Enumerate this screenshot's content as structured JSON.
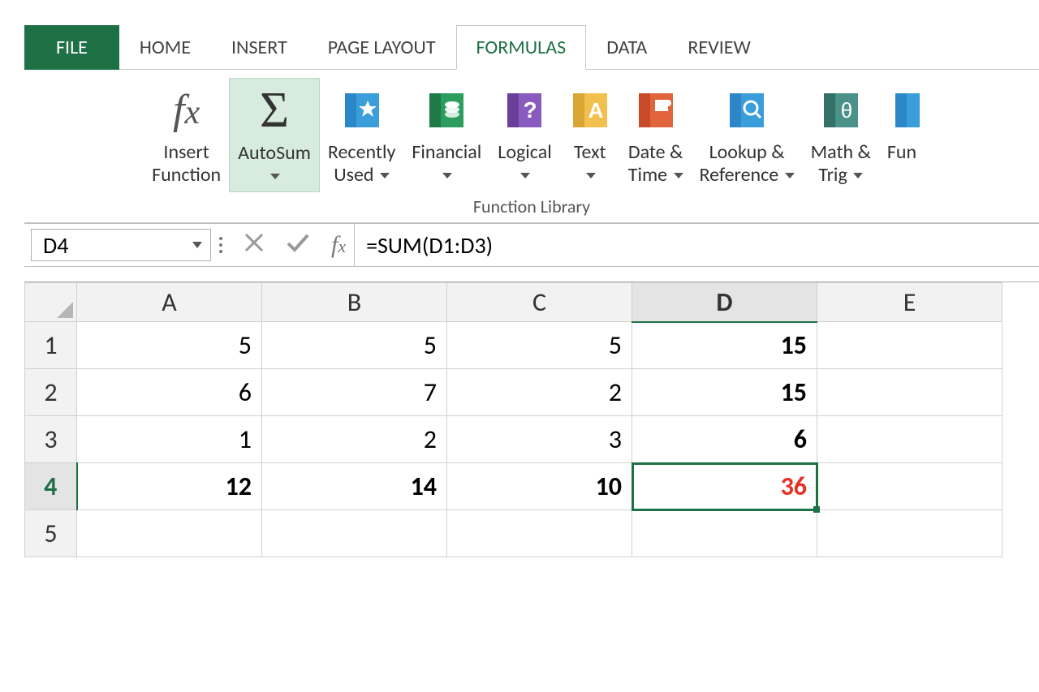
{
  "tabs": {
    "file": "FILE",
    "home": "HOME",
    "insert": "INSERT",
    "page_layout": "PAGE LAYOUT",
    "formulas": "FORMULAS",
    "data": "DATA",
    "review": "REVIEW"
  },
  "ribbon": {
    "group_title": "Function Library",
    "buttons": {
      "insert_function": "Insert\nFunction",
      "autosum": "AutoSum",
      "recently_used": "Recently\nUsed",
      "financial": "Financial",
      "logical": "Logical",
      "text": "Text",
      "date_time": "Date &\nTime",
      "lookup_ref": "Lookup &\nReference",
      "math_trig": "Math &\nTrig",
      "more_fun": "Fun"
    }
  },
  "formula_bar": {
    "name_box": "D4",
    "formula": "=SUM(D1:D3)"
  },
  "grid": {
    "columns": [
      "A",
      "B",
      "C",
      "D",
      "E"
    ],
    "rows": [
      "1",
      "2",
      "3",
      "4",
      "5"
    ],
    "selected_col": "D",
    "selected_row": "4",
    "cells": [
      [
        {
          "v": "5"
        },
        {
          "v": "5"
        },
        {
          "v": "5"
        },
        {
          "v": "15",
          "bold": true
        },
        {
          "v": ""
        }
      ],
      [
        {
          "v": "6"
        },
        {
          "v": "7"
        },
        {
          "v": "2"
        },
        {
          "v": "15",
          "bold": true
        },
        {
          "v": ""
        }
      ],
      [
        {
          "v": "1"
        },
        {
          "v": "2"
        },
        {
          "v": "3"
        },
        {
          "v": "6",
          "bold": true
        },
        {
          "v": ""
        }
      ],
      [
        {
          "v": "12",
          "bold": true
        },
        {
          "v": "14",
          "bold": true
        },
        {
          "v": "10",
          "bold": true
        },
        {
          "v": "36",
          "bold": true,
          "red": true,
          "selected": true
        },
        {
          "v": ""
        }
      ],
      [
        {
          "v": ""
        },
        {
          "v": ""
        },
        {
          "v": ""
        },
        {
          "v": ""
        },
        {
          "v": ""
        }
      ]
    ]
  }
}
